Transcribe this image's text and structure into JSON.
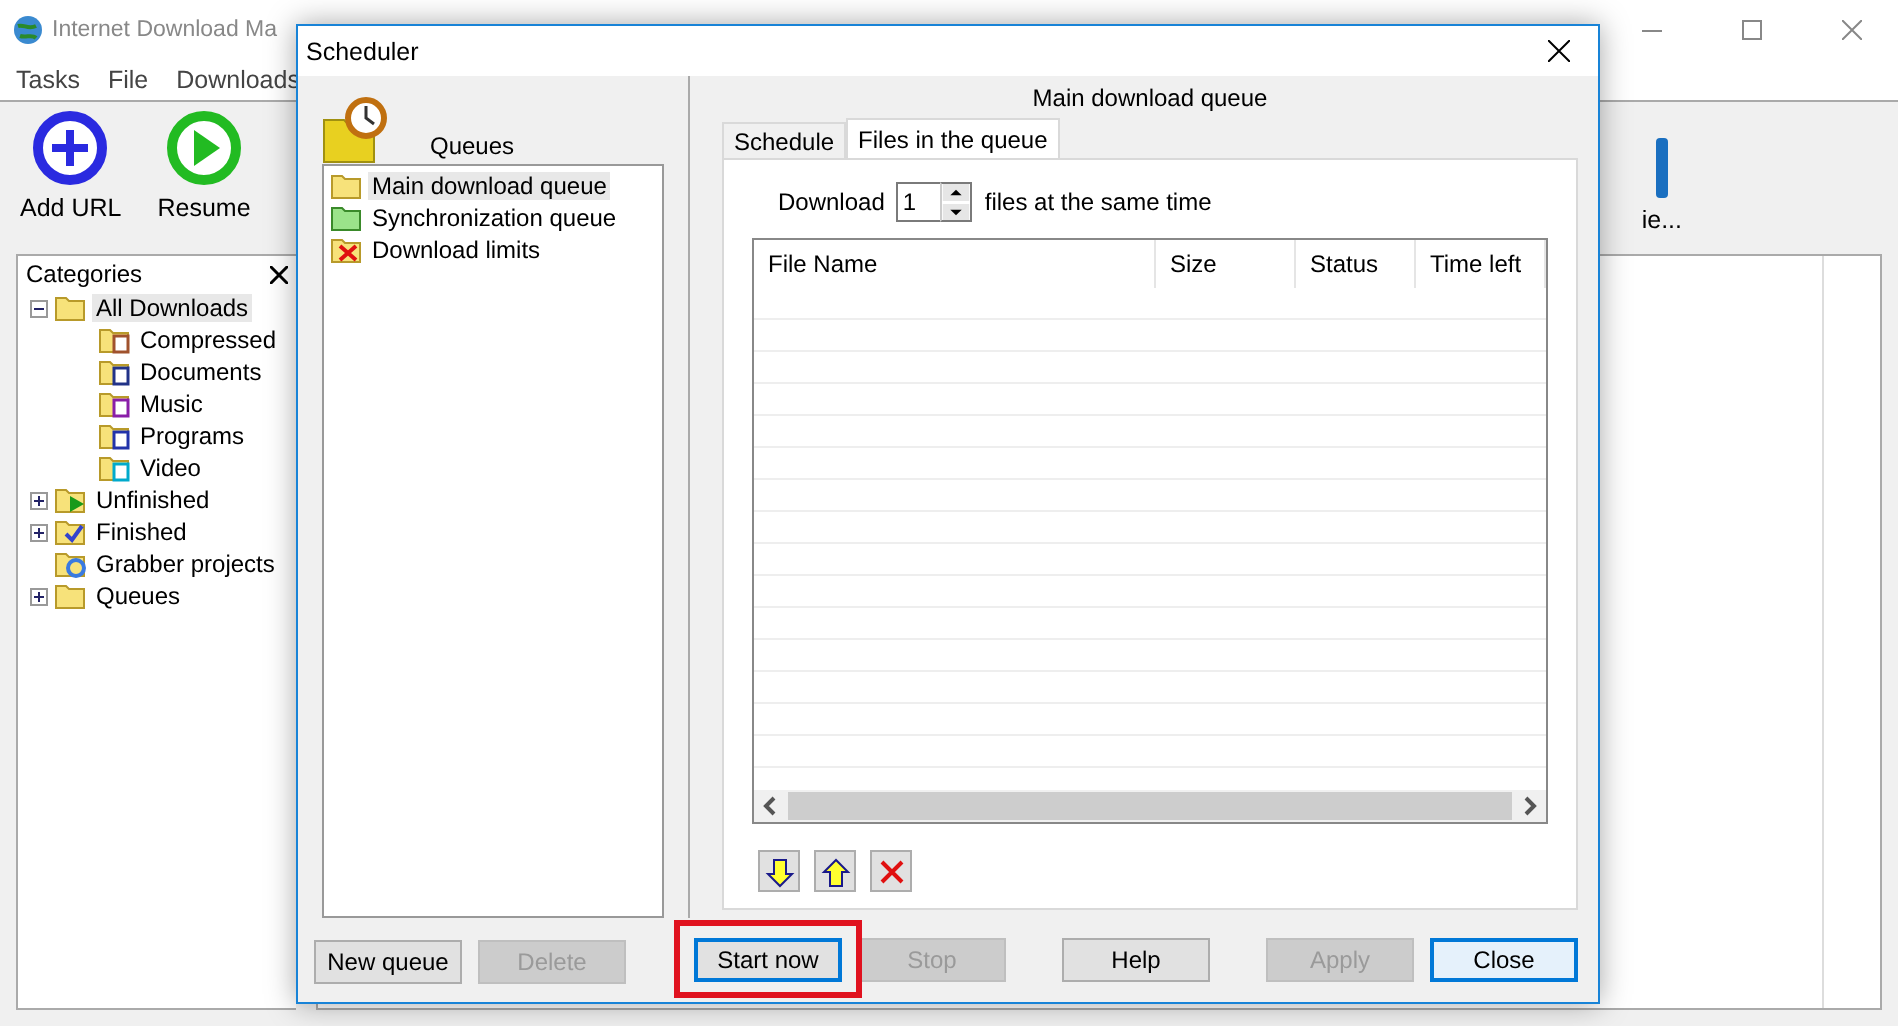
{
  "app_window": {
    "title": "Internet Download Ma",
    "menu": [
      "Tasks",
      "File",
      "Downloads"
    ],
    "toolbar": [
      {
        "label": "Add URL",
        "kind": "add"
      },
      {
        "label": "Resume",
        "kind": "resume"
      },
      {
        "label": "ie...",
        "kind": "partial"
      }
    ],
    "categories": {
      "title": "Categories",
      "tree": [
        {
          "label": "All Downloads",
          "kind": "folder",
          "selected": true,
          "expanded": true,
          "children": [
            {
              "label": "Compressed",
              "kind": "compressed",
              "selected": false
            },
            {
              "label": "Documents",
              "kind": "documents",
              "selected": false
            },
            {
              "label": "Music",
              "kind": "music",
              "selected": false
            },
            {
              "label": "Programs",
              "kind": "programs",
              "selected": false
            },
            {
              "label": "Video",
              "kind": "video",
              "selected": false
            }
          ]
        },
        {
          "label": "Unfinished",
          "kind": "unfinished",
          "selected": false,
          "expanded": false
        },
        {
          "label": "Finished",
          "kind": "finished",
          "selected": false,
          "expanded": false
        },
        {
          "label": "Grabber projects",
          "kind": "grabber",
          "selected": false
        },
        {
          "label": "Queues",
          "kind": "queues",
          "selected": false,
          "expanded": false
        }
      ]
    }
  },
  "scheduler": {
    "title": "Scheduler",
    "queues_label": "Queues",
    "queues": [
      {
        "name": "Main download queue",
        "kind": "main",
        "selected": true
      },
      {
        "name": "Synchronization queue",
        "kind": "sync",
        "selected": false
      },
      {
        "name": "Download limits",
        "kind": "limits",
        "selected": false
      }
    ],
    "queue_buttons": [
      {
        "label": "New queue",
        "disabled": false
      },
      {
        "label": "Delete",
        "disabled": true
      }
    ],
    "queue_title": "Main download queue",
    "tabs": [
      {
        "label": "Schedule",
        "selected": false
      },
      {
        "label": "Files in the queue",
        "selected": true
      }
    ],
    "download_label": "Download",
    "concurrent": "1",
    "concurrent_suffix": "files at the same time",
    "columns": [
      "File Name",
      "Size",
      "Status",
      "Time left"
    ],
    "file_actions": [
      {
        "kind": "down"
      },
      {
        "kind": "up"
      },
      {
        "kind": "delete"
      }
    ],
    "buttons": [
      {
        "label": "Start now",
        "disabled": false,
        "focused": true,
        "highlighted": true
      },
      {
        "label": "Stop",
        "disabled": true,
        "focused": false,
        "highlighted": false
      },
      {
        "label": "Help",
        "disabled": false,
        "focused": false,
        "highlighted": false
      },
      {
        "label": "Apply",
        "disabled": true,
        "focused": false,
        "highlighted": false
      },
      {
        "label": "Close",
        "disabled": false,
        "focused": true,
        "highlighted": false
      }
    ]
  }
}
